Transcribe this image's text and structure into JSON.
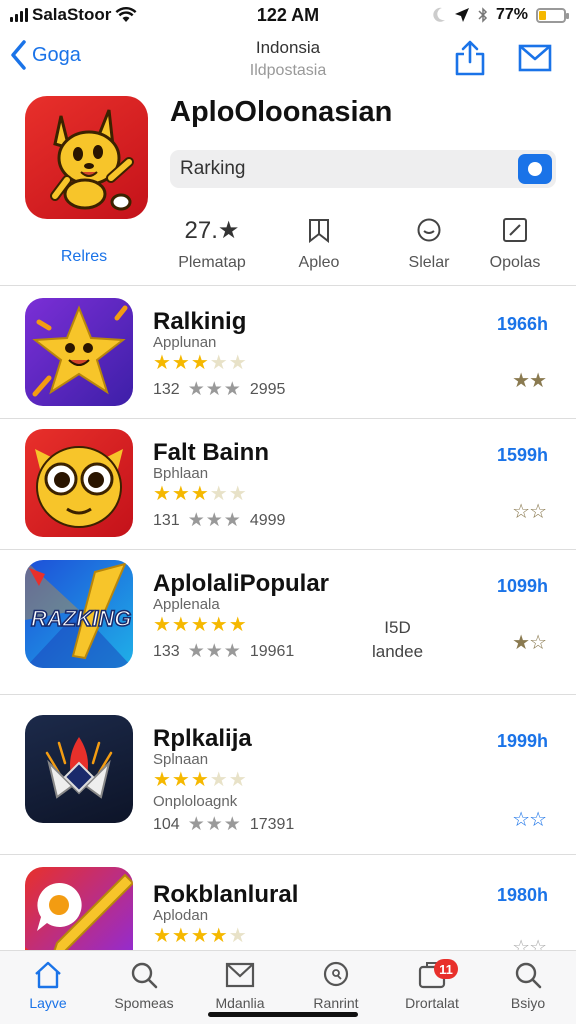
{
  "status": {
    "carrier": "SalaStoor",
    "time": "122 AM",
    "battery": "77%"
  },
  "nav": {
    "back_label": "Goga",
    "title": "Indonsia",
    "subtitle": "Ildpostasia"
  },
  "header": {
    "app_title": "AploOloonasian",
    "search_text": "Rarking",
    "icon_label": "Relres",
    "stats": [
      {
        "top": "27.★",
        "label": "Plematap"
      },
      {
        "top": "",
        "label": "Apleo"
      },
      {
        "top": "",
        "label": "Slelar"
      },
      {
        "top": "",
        "label": "Opolas"
      }
    ]
  },
  "apps": [
    {
      "name": "Ralkinig",
      "sub": "Applunan",
      "stars": 3.5,
      "meta_num": "132",
      "meta_count": "2995",
      "price": "1966h",
      "fav": "★★",
      "fav_blue": false
    },
    {
      "name": "Falt Bainn",
      "sub": "Bphlaan",
      "stars": 3.5,
      "meta_num": "131",
      "meta_count": "4999",
      "price": "1599h",
      "fav": "☆☆",
      "fav_blue": false
    },
    {
      "name": "AplolaliPopular",
      "sub": "Applenala",
      "stars": 5,
      "meta_num": "133",
      "meta_count": "19961",
      "price": "1099h",
      "fav": "★☆",
      "fav_blue": false,
      "extra_top": "I5D",
      "extra_bottom": "landee"
    },
    {
      "name": "Rplkalija",
      "sub": "Splnaan",
      "sub2": "Onploloagnk",
      "stars": 3,
      "meta_num": "104",
      "meta_count": "17391",
      "price": "1999h",
      "fav": "☆☆",
      "fav_blue": true
    },
    {
      "name": "Rokblanlural",
      "sub": "Aplodan",
      "stars": 4,
      "meta_num": "",
      "meta_count": "",
      "price": "1980h",
      "fav": "☆☆",
      "fav_blue": false
    }
  ],
  "tabs": [
    {
      "label": "Layve",
      "active": true
    },
    {
      "label": "Spomeas",
      "active": false
    },
    {
      "label": "Mdanlia",
      "active": false
    },
    {
      "label": "Ranrint",
      "active": false
    },
    {
      "label": "Drortalat",
      "active": false,
      "badge": "11"
    },
    {
      "label": "Bsiyo",
      "active": false
    }
  ],
  "colors": {
    "accent": "#1a73e8",
    "star": "#f5b800",
    "badge": "#e8302b"
  }
}
